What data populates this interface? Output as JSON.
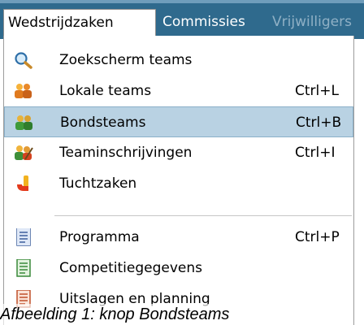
{
  "menubar": {
    "items": [
      {
        "label": "Wedstrijdzaken",
        "state": "active"
      },
      {
        "label": "Commissies",
        "state": "normal"
      },
      {
        "label": "Vrijwilligers",
        "state": "disabled"
      }
    ]
  },
  "dropdown": {
    "items": [
      {
        "label": "Zoekscherm teams",
        "shortcut": "",
        "icon": "magnifier-icon"
      },
      {
        "label": "Lokale teams",
        "shortcut": "Ctrl+L",
        "icon": "team-orange-icon"
      },
      {
        "label": "Bondsteams",
        "shortcut": "Ctrl+B",
        "icon": "team-green-icon",
        "highlighted": true
      },
      {
        "label": "Teaminschrijvingen",
        "shortcut": "Ctrl+I",
        "icon": "team-register-icon"
      },
      {
        "label": "Tuchtzaken",
        "shortcut": "",
        "icon": "disciplinary-icon"
      },
      {
        "label": "Programma",
        "shortcut": "Ctrl+P",
        "icon": "document-blue-icon"
      },
      {
        "label": "Competitiegegevens",
        "shortcut": "",
        "icon": "document-green-icon"
      },
      {
        "label": "Uitslagen en planning",
        "shortcut": "",
        "icon": "document-orange-icon"
      }
    ]
  },
  "caption": "Afbeelding 1: knop  Bondsteams",
  "colors": {
    "menubar": "#2f6a8d",
    "highlight": "#b9d2e3"
  }
}
